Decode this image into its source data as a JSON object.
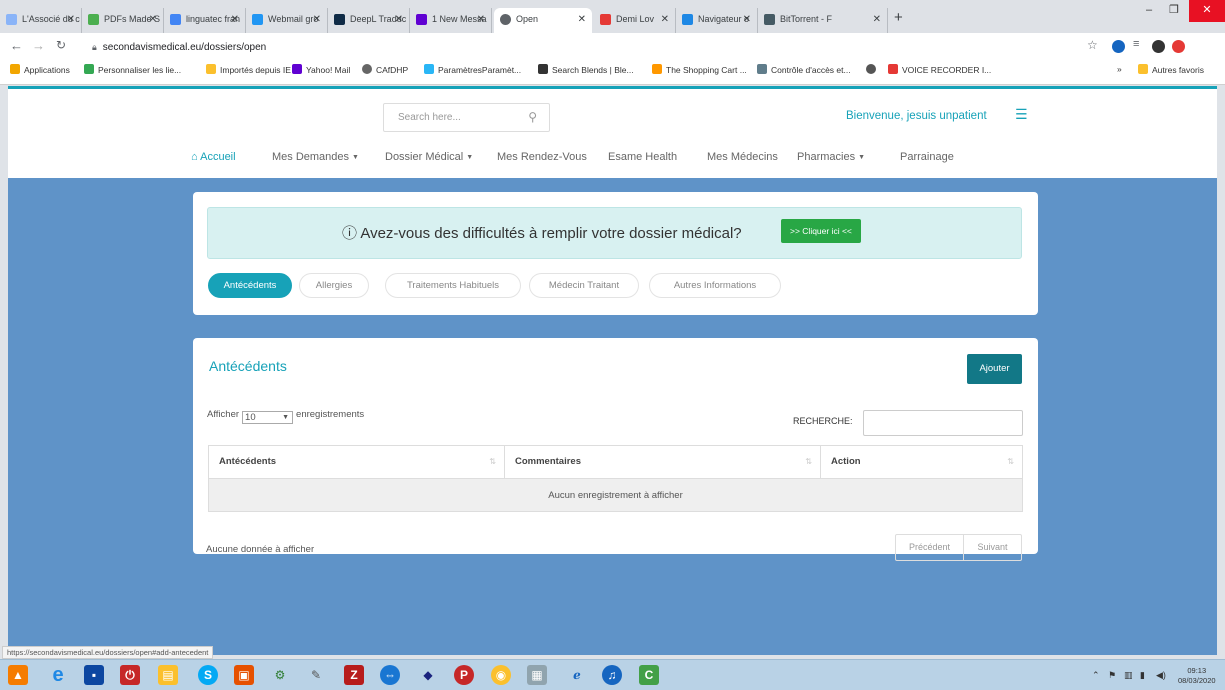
{
  "browser": {
    "tabs": [
      {
        "title": "L'Associé du c"
      },
      {
        "title": "PDFs Made S"
      },
      {
        "title": "linguatec fran"
      },
      {
        "title": "Webmail gro"
      },
      {
        "title": "DeepL Traduc"
      },
      {
        "title": "1 New Messa"
      },
      {
        "title": "Open"
      },
      {
        "title": "Demi Lov"
      },
      {
        "title": "Navigateur o"
      },
      {
        "title": "BitTorrent - F"
      }
    ],
    "new_tab": "+",
    "window_controls": {
      "minimize": "–",
      "maximize": "❐",
      "close": "✕"
    },
    "url": "secondavismedical.eu/dossiers/open",
    "bookmarks": [
      {
        "label": "Applications"
      },
      {
        "label": "Personnaliser les lie..."
      },
      {
        "label": "Importés depuis IE"
      },
      {
        "label": "Yahoo! Mail"
      },
      {
        "label": "CAfDHP"
      },
      {
        "label": "ParamètresParamèt..."
      },
      {
        "label": "Search Blends | Ble..."
      },
      {
        "label": "The Shopping Cart ..."
      },
      {
        "label": "Contrôle d'accès et..."
      },
      {
        "label": ""
      },
      {
        "label": "VOICE RECORDER I..."
      }
    ],
    "bookmarks_more": "»",
    "other_bookmarks": "Autres favoris",
    "status_url": "https://secondavismedical.eu/dossiers/open#add-antecedent"
  },
  "header": {
    "search_placeholder": "Search here...",
    "welcome": "Bienvenue, jesuis unpatient"
  },
  "nav": {
    "items": [
      {
        "label": "Accueil"
      },
      {
        "label": "Mes Demandes"
      },
      {
        "label": "Dossier Médical"
      },
      {
        "label": "Mes Rendez-Vous"
      },
      {
        "label": "Esame Health"
      },
      {
        "label": "Mes Médecins"
      },
      {
        "label": "Pharmacies"
      },
      {
        "label": "Parrainage"
      }
    ]
  },
  "help": {
    "question": "Avez-vous des difficultés à remplir votre dossier médical?",
    "button": ">> Cliquer ici <<"
  },
  "tabs": [
    {
      "label": "Antécédents"
    },
    {
      "label": "Allergies"
    },
    {
      "label": "Traitements Habituels"
    },
    {
      "label": "Médecin Traitant"
    },
    {
      "label": "Autres Informations"
    }
  ],
  "section": {
    "title": "Antécédents",
    "add_button": "Ajouter",
    "show_prefix": "Afficher",
    "show_value": "10",
    "show_suffix": "enregistrements",
    "search_label": "RECHERCHE:",
    "columns": [
      "Antécédents",
      "Commentaires",
      "Action"
    ],
    "empty_message": "Aucun enregistrement à afficher",
    "info": "Aucune donnée à afficher",
    "prev": "Précédent",
    "next": "Suivant"
  },
  "taskbar": {
    "time": "09:13",
    "date": "08/03/2020"
  },
  "colors": {
    "accent": "#17a2b8",
    "page_background": "#5f93c8",
    "add_button": "#127887",
    "help_button": "#28a745"
  }
}
